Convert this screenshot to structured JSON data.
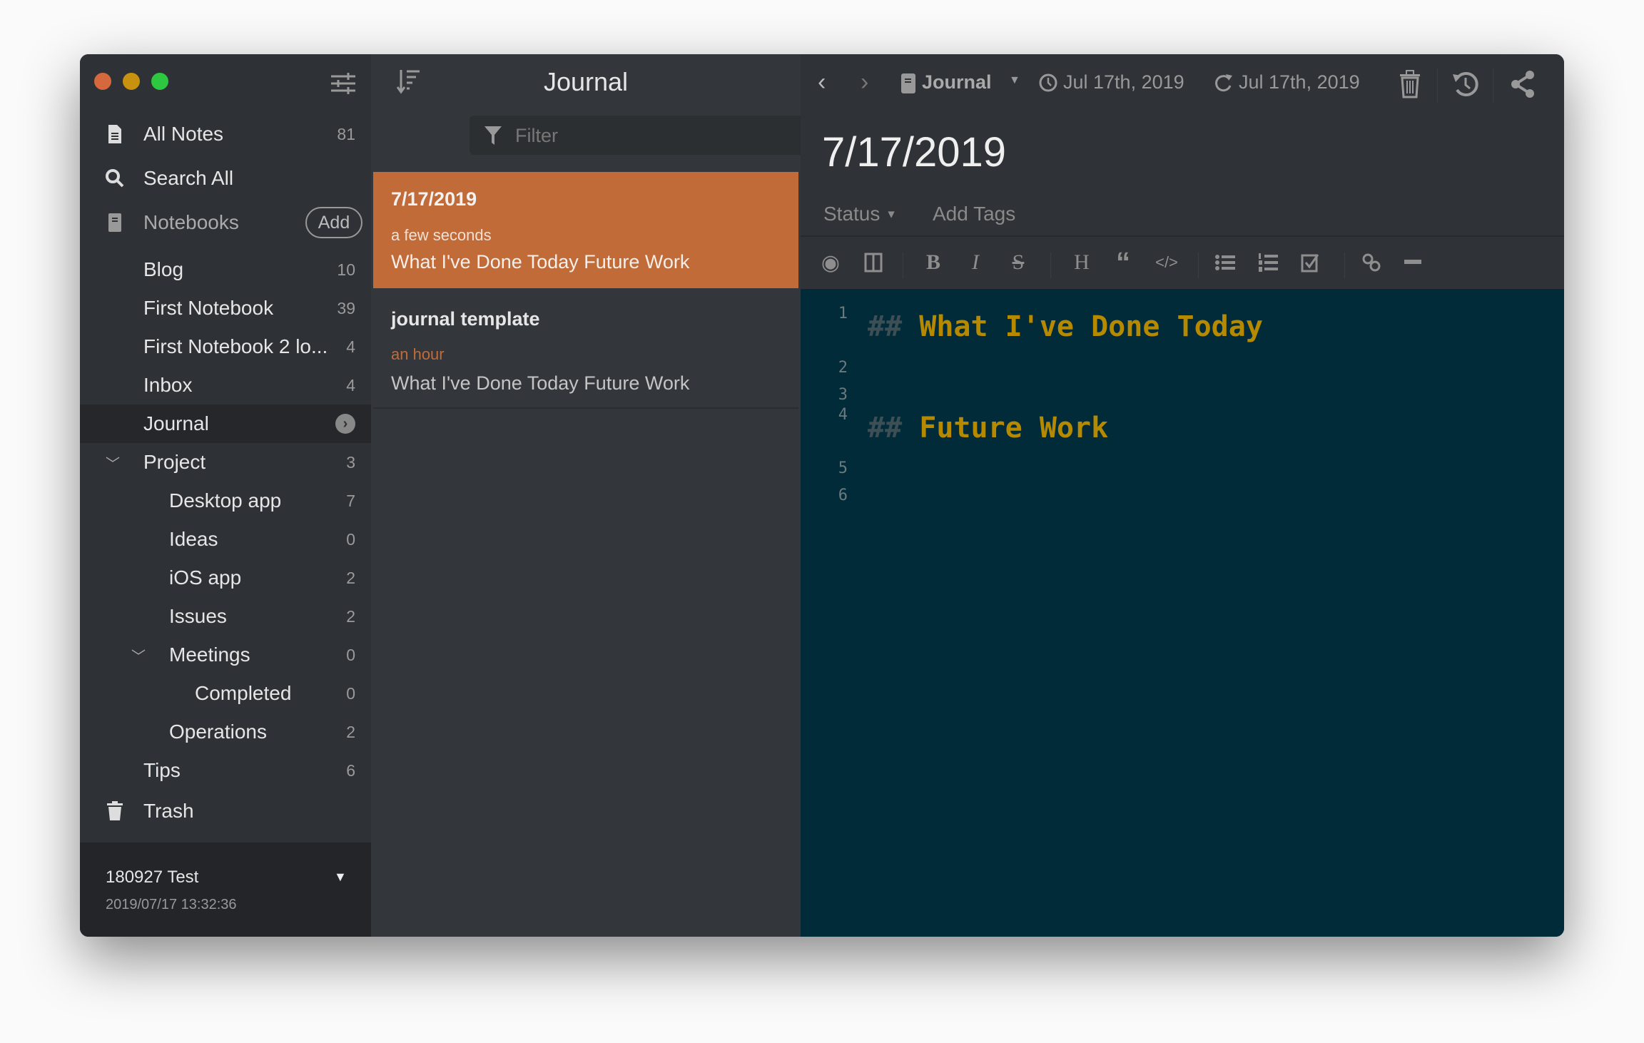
{
  "colors": {
    "accent": "#c16b38",
    "editor_bg": "#012b38",
    "heading": "#b58900",
    "close": "#d5683c",
    "minimize": "#c8920f",
    "zoom": "#2ec840"
  },
  "sidebar": {
    "all_notes": {
      "label": "All Notes",
      "count": "81"
    },
    "search_all": {
      "label": "Search All"
    },
    "notebooks": {
      "label": "Notebooks",
      "add_label": "Add"
    },
    "items": [
      {
        "label": "Blog",
        "count": "10"
      },
      {
        "label": "First Notebook",
        "count": "39"
      },
      {
        "label": "First Notebook 2 lo...",
        "count": "4"
      },
      {
        "label": "Inbox",
        "count": "4"
      },
      {
        "label": "Journal",
        "count": ""
      },
      {
        "label": "Project",
        "count": "3"
      },
      {
        "label": "Desktop app",
        "count": "7"
      },
      {
        "label": "Ideas",
        "count": "0"
      },
      {
        "label": "iOS app",
        "count": "2"
      },
      {
        "label": "Issues",
        "count": "2"
      },
      {
        "label": "Meetings",
        "count": "0"
      },
      {
        "label": "Completed",
        "count": "0"
      },
      {
        "label": "Operations",
        "count": "2"
      },
      {
        "label": "Tips",
        "count": "6"
      }
    ],
    "trash": {
      "label": "Trash"
    },
    "footer": {
      "name": "180927 Test",
      "timestamp": "2019/07/17 13:32:36"
    }
  },
  "list": {
    "title": "Journal",
    "filter_placeholder": "Filter",
    "notes": [
      {
        "title": "7/17/2019",
        "time": "a few seconds",
        "preview": "What I've Done Today Future Work"
      },
      {
        "title": "journal template",
        "time": "an hour",
        "preview": "What I've Done Today Future Work"
      }
    ]
  },
  "editor": {
    "notebook": "Journal",
    "created": "Jul 17th, 2019",
    "updated": "Jul 17th, 2019",
    "title": "7/17/2019",
    "status": "Status",
    "add_tags": "Add Tags",
    "lines": [
      {
        "n": "1",
        "hash": "##",
        "text": "What I've Done Today"
      },
      {
        "n": "2",
        "hash": "",
        "text": ""
      },
      {
        "n": "3",
        "hash": "",
        "text": ""
      },
      {
        "n": "4",
        "hash": "##",
        "text": "Future Work"
      },
      {
        "n": "5",
        "hash": "",
        "text": ""
      },
      {
        "n": "6",
        "hash": "",
        "text": ""
      }
    ]
  }
}
